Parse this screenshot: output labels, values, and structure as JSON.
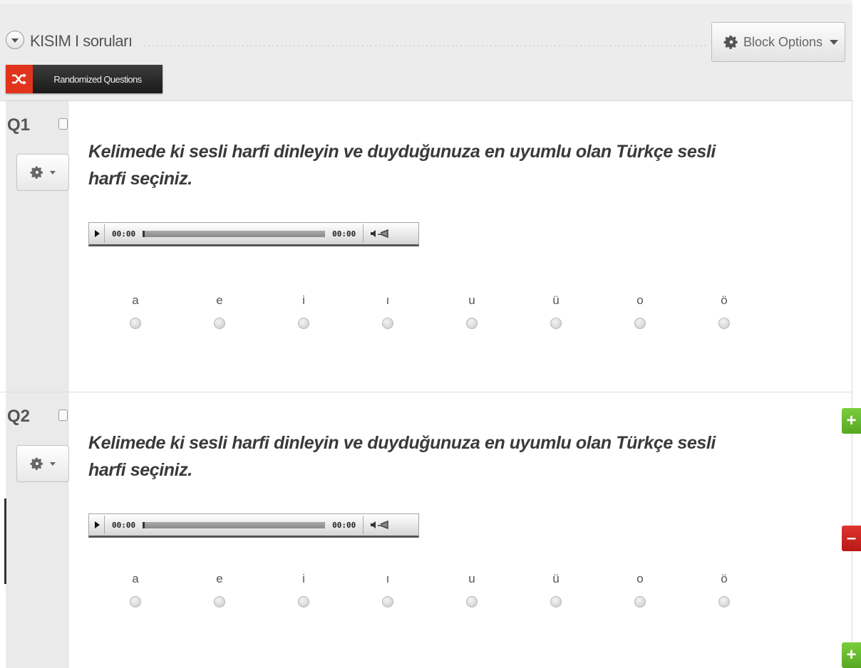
{
  "block": {
    "title": "KISIM I soruları",
    "options_label": "Block Options",
    "randomized_label": "Randomized Questions"
  },
  "questions": [
    {
      "number": "Q1",
      "text": "Kelimede ki sesli harfi dinleyin ve duyduğunuza en uyumlu olan Türkçe sesli harfi seçiniz.",
      "audio": {
        "current_time": "00:00",
        "duration": "00:00"
      },
      "choices": [
        "a",
        "e",
        "i",
        "ı",
        "u",
        "ü",
        "o",
        "ö"
      ]
    },
    {
      "number": "Q2",
      "text": "Kelimede ki sesli harfi dinleyin ve duyduğunuza en uyumlu olan Türkçe sesli harfi seçiniz.",
      "audio": {
        "current_time": "00:00",
        "duration": "00:00"
      },
      "choices": [
        "a",
        "e",
        "i",
        "ı",
        "u",
        "ü",
        "o",
        "ö"
      ]
    }
  ],
  "side_actions": [
    {
      "icon": "plus-icon",
      "label": "+",
      "color": "#6cbf30"
    },
    {
      "icon": "minus-icon",
      "label": "–",
      "color": "#cc2520"
    },
    {
      "icon": "plus-icon",
      "label": "+",
      "color": "#6cbf30"
    }
  ],
  "colors": {
    "header_bg": "#ececec",
    "randomize_red": "#e2341c",
    "add_green": "#6cbf30",
    "remove_red": "#cc2520"
  }
}
